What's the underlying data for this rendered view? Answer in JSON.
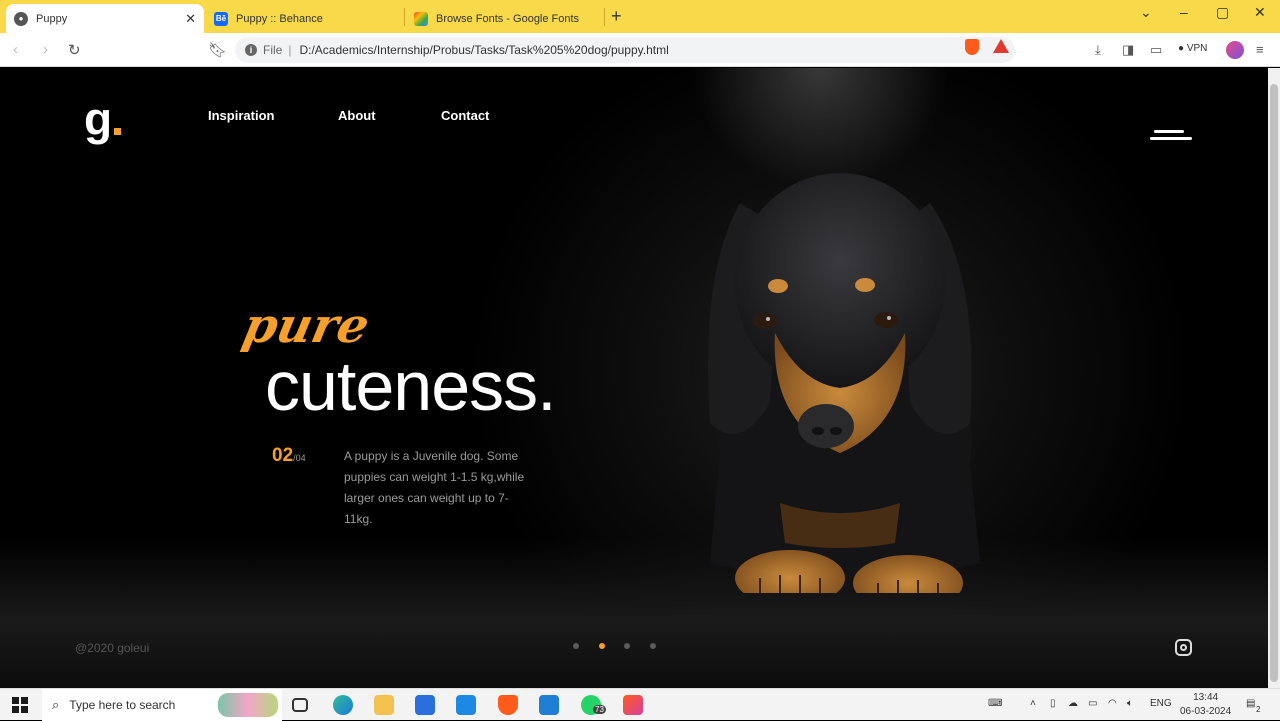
{
  "browser": {
    "tabs": [
      {
        "title": "Puppy",
        "active": true
      },
      {
        "title": "Puppy :: Behance",
        "active": false
      },
      {
        "title": "Browse Fonts - Google Fonts",
        "active": false
      }
    ],
    "address": {
      "scheme_label": "File",
      "url": "D:/Academics/Internship/Probus/Tasks/Task%205%20dog/puppy.html"
    },
    "vpn_label": "VPN",
    "colors": {
      "tabbar": "#f7d94a",
      "accent": "#f5a02c"
    }
  },
  "site": {
    "logo": "g",
    "nav": [
      "Inspiration",
      "About",
      "Contact"
    ],
    "hero": {
      "kicker": "pure",
      "title": "cuteness.",
      "counter_current": "02",
      "counter_total": "/04",
      "description": "A puppy is a Juvenile dog. Some puppies can weight 1-1.5 kg,while larger ones can weight up to 7-11kg."
    },
    "copyright": "@2020 goleui",
    "slider": {
      "count": 4,
      "active_index": 1
    }
  },
  "taskbar": {
    "search_placeholder": "Type here to search",
    "whatsapp_badge": "73",
    "language": "ENG",
    "time": "13:44",
    "date": "06-03-2024",
    "notifications": "2"
  }
}
